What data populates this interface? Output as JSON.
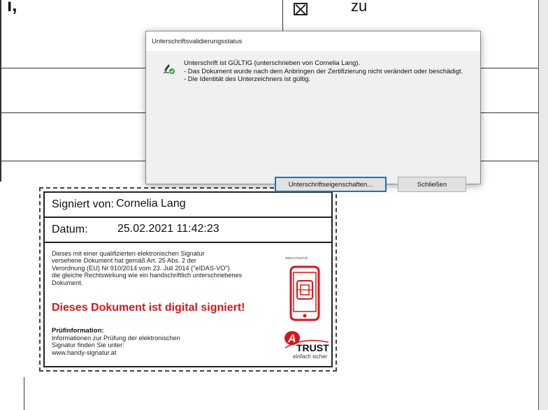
{
  "document": {
    "top_fragment": "ı,",
    "top_word": "zu"
  },
  "stamp": {
    "signer_label": "Signiert von:",
    "signer_value": "Cornelia Lang",
    "date_label": "Datum:",
    "date_value": "25.02.2021 11:42:23",
    "legal_text": "Dieses mit einer qualifizierten elektronischen Signatur\nversehene Dokument hat gemäß Art. 25 Abs. 2 der\nVerordnung (EU) Nr 910/2014 vom 23. Juli 2014 (\"eIDAS-VO\")\ndie gleiche Rechtswirkung wie ein handschriftlich unterschriebenes\nDokument.",
    "digital_signed": "Dieses Dokument ist digital signiert!",
    "pruef_heading": "Prüfinformation:",
    "pruef_text": "Informationen zur Prüfung der elektronischen\nSignatur finden Sie unter:\nwww.handy-signatur.at",
    "atrust_url": "www.a-trust.at",
    "trust_word": "TRUST",
    "trust_tagline": "einfach sicher",
    "accent_color": "#d3181c"
  },
  "dialog": {
    "title": "Unterschriftsvalidierungsstatus",
    "status_icon": "valid-signature-icon",
    "line1": "Unterschrift ist GÜLTIG (unterschrieben von Cornelia Lang).",
    "line2": "- Das Dokument wurde nach dem Anbringen der Zertifizierung nicht verändert oder beschädigt.",
    "line3": "- Die Identität des Unterzeichners ist gültig.",
    "properties_button": "Unterschriftseigenschaften...",
    "close_button": "Schließen"
  }
}
